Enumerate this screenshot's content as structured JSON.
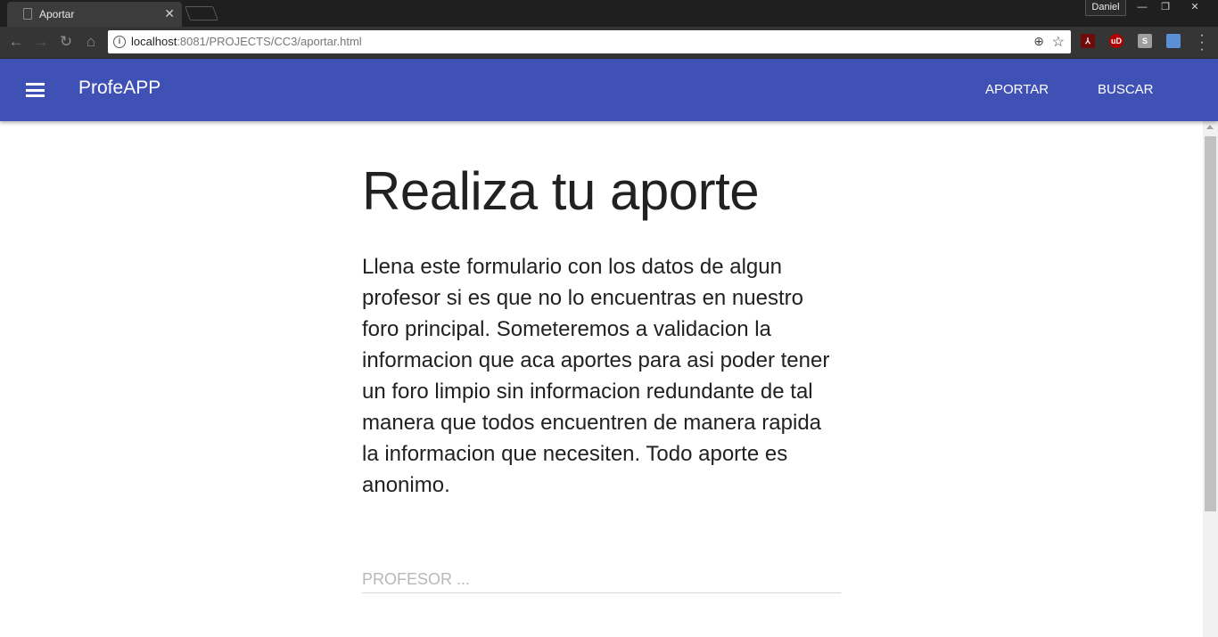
{
  "browser": {
    "tab_title": "Aportar",
    "tab_close": "✕",
    "profile_name": "Daniel",
    "window": {
      "minimize": "—",
      "restore": "❐",
      "close": "✕"
    },
    "url_host": "localhost",
    "url_rest": ":8081/PROJECTS/CC3/aportar.html",
    "extensions": [
      {
        "name": "pdf-extension",
        "label": "",
        "color": "#8b0000"
      },
      {
        "name": "ublock-extension",
        "label": "uD",
        "color": "#b00000"
      },
      {
        "name": "s-extension",
        "label": "S",
        "color": "#9e9e9e"
      },
      {
        "name": "screenshot-extension",
        "label": "",
        "color": "#5b8fd6"
      }
    ]
  },
  "appbar": {
    "brand": "ProfeAPP",
    "nav": {
      "aportar": "APORTAR",
      "buscar": "BUSCAR"
    },
    "color": "#3f51b5"
  },
  "main": {
    "title": "Realiza tu aporte",
    "intro": "Llena este formulario con los datos de algun profesor si es que no lo encuentras en nuestro foro principal. Someteremos a validacion la informacion que aca aportes para asi poder tener un foro limpio sin informacion redundante de tal manera que todos encuentren de manera rapida la informacion que necesiten. Todo aporte es anonimo.",
    "profesor_field": {
      "placeholder": "PROFESOR ...",
      "value": ""
    }
  }
}
